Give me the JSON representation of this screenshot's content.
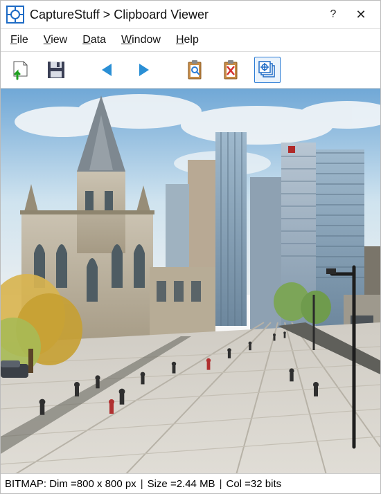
{
  "titlebar": {
    "app_name": "CaptureStuff",
    "separator": " > ",
    "subtitle": "Clipboard Viewer",
    "help_label": "?",
    "close_label": "✕"
  },
  "menubar": {
    "file": "File",
    "view": "View",
    "data": "Data",
    "window": "Window",
    "help": "Help"
  },
  "toolbar": {
    "icons": {
      "open": "open-icon",
      "save": "save-icon",
      "prev": "prev-icon",
      "next": "next-icon",
      "find_clipboard": "find-clipboard-icon",
      "delete_clipboard": "delete-clipboard-icon",
      "capture_stack": "capture-stack-icon"
    }
  },
  "statusbar": {
    "format_label": "BITMAP:",
    "dim_label": "Dim = ",
    "dim_value": "800 x 800 px",
    "size_label": "Size = ",
    "size_value": "2.44 MB",
    "col_label": "Col = ",
    "col_value": "32 bits"
  }
}
